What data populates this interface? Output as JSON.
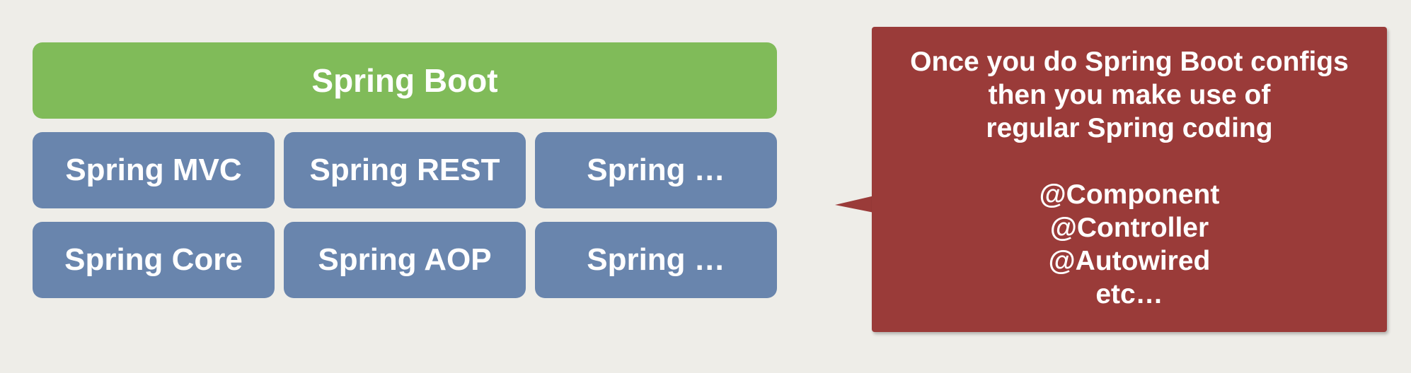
{
  "stack": {
    "top": "Spring Boot",
    "row1": [
      "Spring MVC",
      "Spring REST",
      "Spring …"
    ],
    "row2": [
      "Spring Core",
      "Spring AOP",
      "Spring …"
    ]
  },
  "callout": {
    "lines": [
      "Once you do Spring Boot configs",
      "then you make use of",
      "regular Spring coding",
      "",
      "@Component",
      "@Controller",
      "@Autowired",
      "etc…"
    ]
  },
  "colors": {
    "background": "#eeede8",
    "boot": "#80bb59",
    "module": "#6985ad",
    "callout": "#9a3b39",
    "text": "#ffffff"
  }
}
